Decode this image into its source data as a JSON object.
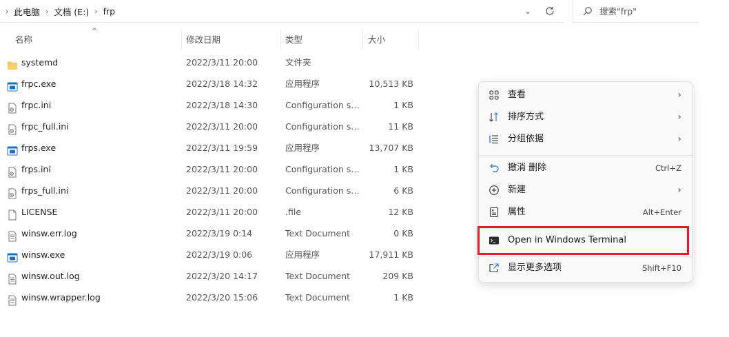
{
  "address": {
    "crumbs": [
      "此电脑",
      "文档 (E:)",
      "frp"
    ]
  },
  "search": {
    "placeholder": "搜索\"frp\""
  },
  "columns": {
    "name": "名称",
    "date": "修改日期",
    "type": "类型",
    "size": "大小"
  },
  "files": [
    {
      "name": "systemd",
      "date": "2022/3/11 20:00",
      "type": "文件夹",
      "size": "",
      "icon": "folder-icon"
    },
    {
      "name": "frpc.exe",
      "date": "2022/3/18 14:32",
      "type": "应用程序",
      "size": "10,513 KB",
      "icon": "exe-icon"
    },
    {
      "name": "frpc.ini",
      "date": "2022/3/18 14:30",
      "type": "Configuration se...",
      "size": "1 KB",
      "icon": "config-file-icon"
    },
    {
      "name": "frpc_full.ini",
      "date": "2022/3/11 20:00",
      "type": "Configuration se...",
      "size": "11 KB",
      "icon": "config-file-icon"
    },
    {
      "name": "frps.exe",
      "date": "2022/3/11 19:59",
      "type": "应用程序",
      "size": "13,707 KB",
      "icon": "exe-icon"
    },
    {
      "name": "frps.ini",
      "date": "2022/3/11 20:00",
      "type": "Configuration se...",
      "size": "1 KB",
      "icon": "config-file-icon"
    },
    {
      "name": "frps_full.ini",
      "date": "2022/3/11 20:00",
      "type": "Configuration se...",
      "size": "6 KB",
      "icon": "config-file-icon"
    },
    {
      "name": "LICENSE",
      "date": "2022/3/11 20:00",
      "type": ".file",
      "size": "12 KB",
      "icon": "blank-file-icon"
    },
    {
      "name": "winsw.err.log",
      "date": "2022/3/19 0:14",
      "type": "Text Document",
      "size": "0 KB",
      "icon": "text-file-icon"
    },
    {
      "name": "winsw.exe",
      "date": "2022/3/19 0:06",
      "type": "应用程序",
      "size": "17,911 KB",
      "icon": "exe-icon"
    },
    {
      "name": "winsw.out.log",
      "date": "2022/3/20 14:17",
      "type": "Text Document",
      "size": "209 KB",
      "icon": "text-file-icon"
    },
    {
      "name": "winsw.wrapper.log",
      "date": "2022/3/20 15:06",
      "type": "Text Document",
      "size": "1 KB",
      "icon": "text-file-icon"
    }
  ],
  "menu": {
    "view": {
      "label": "查看",
      "icon": "grid-icon"
    },
    "sort": {
      "label": "排序方式",
      "icon": "sort-icon"
    },
    "group": {
      "label": "分组依据",
      "icon": "group-list-icon"
    },
    "undo": {
      "label": "撤消 删除",
      "shortcut": "Ctrl+Z",
      "icon": "undo-icon"
    },
    "new": {
      "label": "新建",
      "icon": "plus-circle-icon"
    },
    "properties": {
      "label": "属性",
      "shortcut": "Alt+Enter",
      "icon": "properties-icon"
    },
    "terminal": {
      "label": "Open in Windows Terminal",
      "icon": "terminal-icon"
    },
    "more": {
      "label": "显示更多选项",
      "shortcut": "Shift+F10",
      "icon": "external-icon"
    }
  },
  "colors": {
    "highlight": "#e51c23",
    "folder": "#f6c343",
    "exe": "#1e6fc9"
  }
}
